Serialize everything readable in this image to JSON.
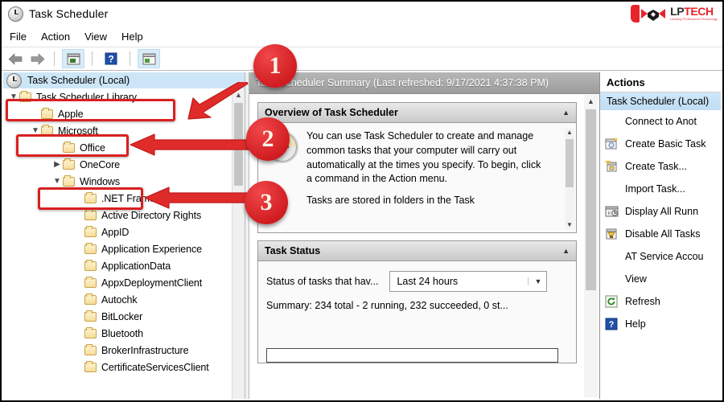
{
  "window": {
    "title": "Task Scheduler",
    "title_icon": "clock-icon"
  },
  "brand": {
    "name_light": "LP",
    "name_bold": "TECH",
    "tagline": "Leading Professional Technology"
  },
  "menubar": {
    "items": [
      {
        "label": "File"
      },
      {
        "label": "Action"
      },
      {
        "label": "View"
      },
      {
        "label": "Help"
      }
    ]
  },
  "toolbar": {
    "back": "←",
    "forward": "→",
    "buttons": [
      {
        "name": "show-hide-console-tree-icon"
      },
      {
        "name": "help-icon"
      },
      {
        "name": "show-hide-action-pane-icon"
      }
    ]
  },
  "tree": {
    "root": {
      "label": "Task Scheduler (Local)",
      "icon": "clock-icon"
    },
    "items": [
      {
        "label": "Task Scheduler Library",
        "indent": 0,
        "chevron": "v",
        "icon": "library-folder-icon",
        "highlight": true
      },
      {
        "label": "Apple",
        "indent": 1,
        "chevron": "",
        "icon": "folder-icon",
        "highlight": false
      },
      {
        "label": "Microsoft",
        "indent": 1,
        "chevron": "v",
        "icon": "folder-icon",
        "highlight": true
      },
      {
        "label": "Office",
        "indent": 2,
        "chevron": "",
        "icon": "folder-icon",
        "highlight": false
      },
      {
        "label": "OneCore",
        "indent": 2,
        "chevron": ">",
        "icon": "folder-icon",
        "highlight": false
      },
      {
        "label": "Windows",
        "indent": 2,
        "chevron": "v",
        "icon": "folder-icon",
        "highlight": true
      },
      {
        "label": ".NET Framework",
        "indent": 3,
        "chevron": "",
        "icon": "folder-icon",
        "highlight": false
      },
      {
        "label": "Active Directory Rights",
        "indent": 3,
        "chevron": "",
        "icon": "folder-icon",
        "highlight": false
      },
      {
        "label": "AppID",
        "indent": 3,
        "chevron": "",
        "icon": "folder-icon",
        "highlight": false
      },
      {
        "label": "Application Experience",
        "indent": 3,
        "chevron": "",
        "icon": "folder-icon",
        "highlight": false
      },
      {
        "label": "ApplicationData",
        "indent": 3,
        "chevron": "",
        "icon": "folder-icon",
        "highlight": false
      },
      {
        "label": "AppxDeploymentClient",
        "indent": 3,
        "chevron": "",
        "icon": "folder-icon",
        "highlight": false
      },
      {
        "label": "Autochk",
        "indent": 3,
        "chevron": "",
        "icon": "folder-icon",
        "highlight": false
      },
      {
        "label": "BitLocker",
        "indent": 3,
        "chevron": "",
        "icon": "folder-icon",
        "highlight": false
      },
      {
        "label": "Bluetooth",
        "indent": 3,
        "chevron": "",
        "icon": "folder-icon",
        "highlight": false
      },
      {
        "label": "BrokerInfrastructure",
        "indent": 3,
        "chevron": "",
        "icon": "folder-icon",
        "highlight": false
      },
      {
        "label": "CertificateServicesClient",
        "indent": 3,
        "chevron": "",
        "icon": "folder-icon",
        "highlight": false
      }
    ]
  },
  "center": {
    "header": "Task Scheduler Summary (Last refreshed: 9/17/2021 4:37:38 PM)",
    "overview": {
      "title": "Overview of Task Scheduler",
      "paragraph_1": "You can use Task Scheduler to create and manage common tasks that your computer will carry out automatically at the times you specify. To begin, click a command in the Action menu.",
      "paragraph_2": "Tasks are stored in folders in the Task"
    },
    "task_status": {
      "title": "Task Status",
      "status_label": "Status of tasks that hav...",
      "range_value": "Last 24 hours",
      "summary": "Summary: 234 total - 2 running, 232 succeeded, 0 st..."
    }
  },
  "actions": {
    "header": "Actions",
    "selected": "Task Scheduler (Local)",
    "items": [
      {
        "label": "Connect to Anot",
        "icon": ""
      },
      {
        "label": "Create Basic Task",
        "icon": "create-basic-task-icon"
      },
      {
        "label": "Create Task...",
        "icon": "create-task-icon"
      },
      {
        "label": "Import Task...",
        "icon": ""
      },
      {
        "label": "Display All Runn",
        "icon": "display-running-tasks-icon"
      },
      {
        "label": "Disable All Tasks",
        "icon": "disable-all-tasks-icon"
      },
      {
        "label": "AT Service Accou",
        "icon": ""
      },
      {
        "label": "View",
        "icon": ""
      },
      {
        "label": "Refresh",
        "icon": "refresh-icon"
      },
      {
        "label": "Help",
        "icon": "help-icon"
      }
    ]
  },
  "annotations": {
    "markers": [
      {
        "number": "1"
      },
      {
        "number": "2"
      },
      {
        "number": "3"
      }
    ],
    "accent_color": "#d92020"
  }
}
